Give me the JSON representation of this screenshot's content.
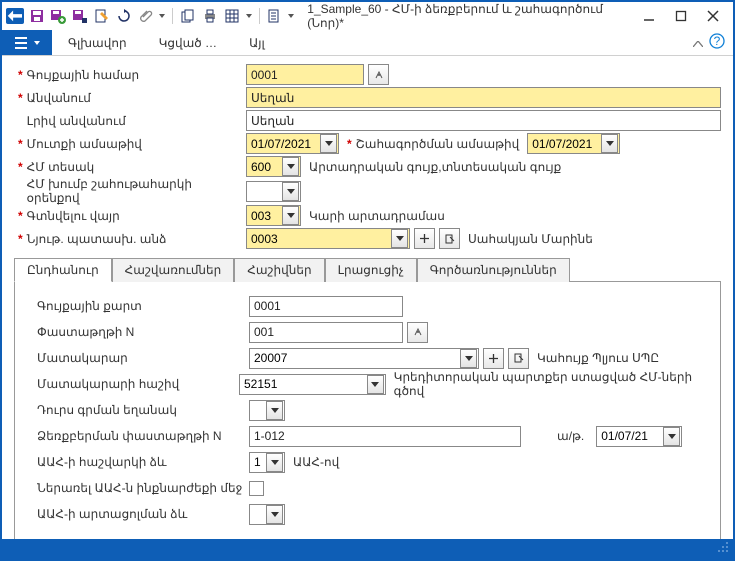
{
  "titlebar": {
    "title": "1_Sample_60 - ՀՄ-ի ձեռքբերում և շահագործում (Նոր)*"
  },
  "menu": {
    "m1": "Գլխավոր",
    "m2": "Կցված …",
    "m3": "Այլ"
  },
  "form": {
    "r1": {
      "label": "Գույքային համար",
      "value": "0001"
    },
    "r2": {
      "label": "Անվանում",
      "value": "Սեղան"
    },
    "r3": {
      "label": "Լրիվ անվանում",
      "value": "Սեղան"
    },
    "r4": {
      "label": "Մուտքի ամսաթիվ",
      "value": "01/07/2021",
      "label2": "Շահագործման ամսաթիվ",
      "value2": "01/07/2021"
    },
    "r5": {
      "label": "ՀՄ տեսակ",
      "value": "600",
      "desc": "Արտադրական գույք,տնտեսական գույք"
    },
    "r6": {
      "label": "ՀՄ խումբ շահութահարկի օրենքով"
    },
    "r7": {
      "label": "Գտնվելու վայր",
      "value": "003",
      "desc": "Կարի արտադրամաս"
    },
    "r8": {
      "label": "Նյութ. պատասխ. անձ",
      "value": "0003",
      "desc": "Սահակյան Մարինե"
    }
  },
  "tabs": {
    "t1": "Ընդհանուր",
    "t2": "Հաշվառումներ",
    "t3": "Հաշիվներ",
    "t4": "Լրացուցիչ",
    "t5": "Գործառնություններ"
  },
  "sub": {
    "r1": {
      "label": "Գույքային քարտ",
      "value": "0001"
    },
    "r2": {
      "label": "Փաստաթղթի N",
      "value": "001"
    },
    "r3": {
      "label": "Մատակարար",
      "value": "20007",
      "desc": "Կահույք Պլյուս ՍՊԸ"
    },
    "r4": {
      "label": "Մատակարարի հաշիվ",
      "value": "52151",
      "desc": "Կրեդիտորական պարտքեր ստացված ՀՄ-ների գծով"
    },
    "r5": {
      "label": "Դուրս գրման եղանակ"
    },
    "r6": {
      "label": "Ձեռքբերման փաստաթղթի N",
      "value": "1-012",
      "datelbl": "ա/թ.",
      "date": "01/07/21"
    },
    "r7": {
      "label": "ԱԱՀ-ի հաշվարկի ձև",
      "value": "1",
      "desc": "ԱԱՀ-ով"
    },
    "r8": {
      "label": "Ներառել ԱԱՀ-ն ինքնարժեքի մեջ"
    },
    "r9": {
      "label": "ԱԱՀ-ի արտացոլման ձև"
    }
  }
}
